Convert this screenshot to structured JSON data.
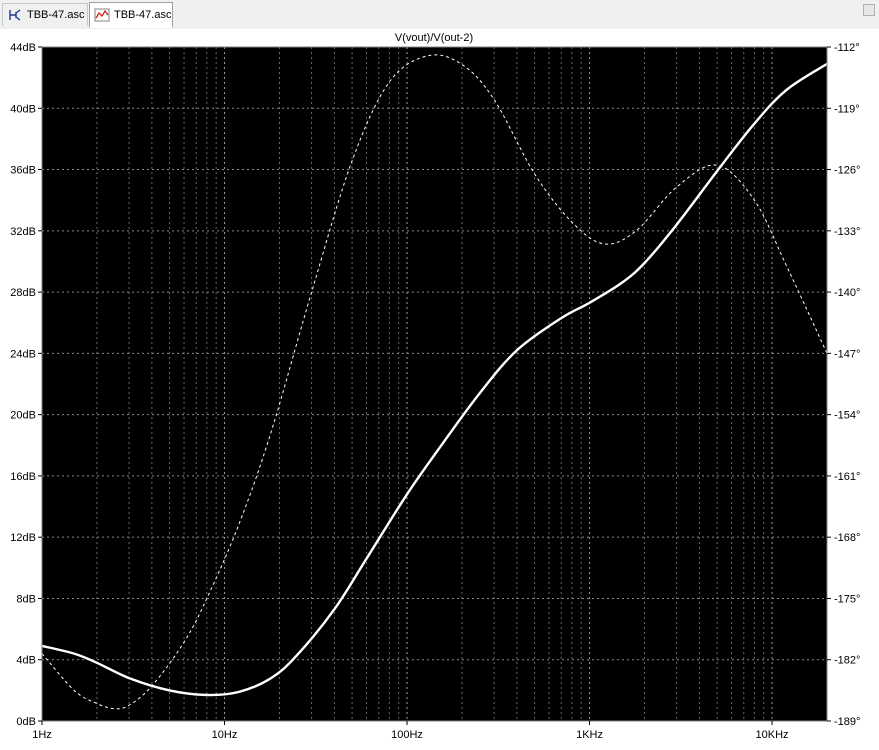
{
  "tabs": [
    {
      "label": "TBB-47.asc",
      "icon": "schematic-icon",
      "active": false
    },
    {
      "label": "TBB-47.asc",
      "icon": "waveform-icon",
      "active": true
    }
  ],
  "chart_data": {
    "type": "line",
    "title": "V(vout)/V(out-2)",
    "x_axis": {
      "scale": "log",
      "range_hz": [
        1,
        20000
      ],
      "tick_labels": [
        "1Hz",
        "10Hz",
        "100Hz",
        "1KHz",
        "10KHz"
      ],
      "tick_values": [
        1,
        10,
        100,
        1000,
        10000
      ]
    },
    "y_left": {
      "unit": "dB",
      "range": [
        0,
        44
      ],
      "tick_labels": [
        "0dB",
        "4dB",
        "8dB",
        "12dB",
        "16dB",
        "20dB",
        "24dB",
        "28dB",
        "32dB",
        "36dB",
        "40dB",
        "44dB"
      ],
      "tick_values": [
        0,
        4,
        8,
        12,
        16,
        20,
        24,
        28,
        32,
        36,
        40,
        44
      ]
    },
    "y_right": {
      "unit": "degrees",
      "range": [
        -189,
        -112
      ],
      "tick_labels": [
        "-189°",
        "-182°",
        "-175°",
        "-168°",
        "-161°",
        "-154°",
        "-147°",
        "-140°",
        "-133°",
        "-126°",
        "-119°",
        "-112°"
      ],
      "tick_values": [
        -189,
        -182,
        -175,
        -168,
        -161,
        -154,
        -147,
        -140,
        -133,
        -126,
        -119,
        -112
      ]
    },
    "grid": true,
    "series": [
      {
        "style": "solid",
        "axis": "left",
        "color": "#ffffff",
        "x": [
          1,
          1.5,
          2,
          3,
          5,
          8,
          12,
          18,
          25,
          40,
          60,
          100,
          150,
          250,
          400,
          700,
          1000,
          1500,
          2000,
          3000,
          5000,
          8000,
          12000,
          20000
        ],
        "y": [
          4.9,
          4.4,
          3.8,
          2.8,
          2.0,
          1.7,
          1.9,
          2.8,
          4.3,
          7.3,
          10.6,
          14.8,
          17.8,
          21.4,
          24.2,
          26.3,
          27.3,
          28.6,
          29.9,
          32.4,
          35.9,
          39.0,
          41.2,
          42.9
        ]
      },
      {
        "style": "dashed",
        "axis": "right",
        "color": "#ffffff",
        "x": [
          1,
          1.5,
          2,
          2.5,
          3,
          4,
          6,
          8,
          12,
          18,
          30,
          50,
          80,
          130,
          200,
          300,
          500,
          800,
          1200,
          1800,
          3000,
          5000,
          8000,
          12000,
          20000
        ],
        "y": [
          -181.3,
          -185.5,
          -187.0,
          -187.6,
          -187.2,
          -185.0,
          -180.0,
          -175.0,
          -166.5,
          -156.0,
          -140.0,
          -125.0,
          -116.0,
          -113.0,
          -114.0,
          -118.0,
          -126.5,
          -132.0,
          -134.5,
          -133.0,
          -128.0,
          -125.5,
          -129.5,
          -137.0,
          -147.0
        ]
      }
    ]
  }
}
